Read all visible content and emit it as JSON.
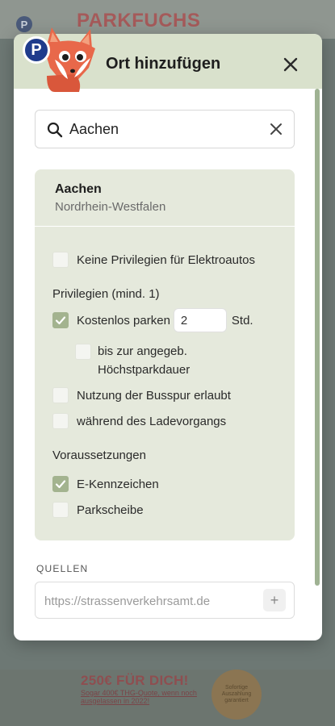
{
  "background": {
    "brand": "PARKFUCHS",
    "logo_letter": "P",
    "promo_title": "250€ FÜR DICH!",
    "promo_sub": "Sogar 400€ THG-Quote, wenn noch ausgelassen in 2022!",
    "promo_stamp": "Sofortige Auszahlung garantiert"
  },
  "dialog": {
    "title": "Ort hinzufügen",
    "logo_letter": "P",
    "search": {
      "value": "Aachen"
    },
    "place": {
      "name": "Aachen",
      "region": "Nordrhein-Westfalen"
    },
    "options": {
      "no_privileges": {
        "label": "Keine Privilegien für Elektroautos",
        "checked": false
      },
      "privileges_heading": "Privilegien (mind. 1)",
      "free_parking": {
        "label": "Kostenlos parken",
        "checked": true,
        "hours": "2",
        "unit": "Std."
      },
      "max_duration": {
        "line1": "bis zur angegeb.",
        "line2": "Höchstparkdauer",
        "checked": false
      },
      "bus_lane": {
        "label": "Nutzung der Busspur erlaubt",
        "checked": false
      },
      "while_charging": {
        "label": "während des Ladevorgangs",
        "checked": false
      },
      "requirements_heading": "Voraussetzungen",
      "e_plate": {
        "label": "E-Kennzeichen",
        "checked": true
      },
      "parking_disc": {
        "label": "Parkscheibe",
        "checked": false
      }
    },
    "sources": {
      "label": "QUELLEN",
      "placeholder": "https://strassenverkehrsamt.de",
      "add_symbol": "+"
    }
  },
  "colors": {
    "header_bg": "#d9e1cc",
    "card_bg": "#e5e9dc",
    "accent_check": "#a3b38f",
    "fox_orange": "#e8684a"
  }
}
